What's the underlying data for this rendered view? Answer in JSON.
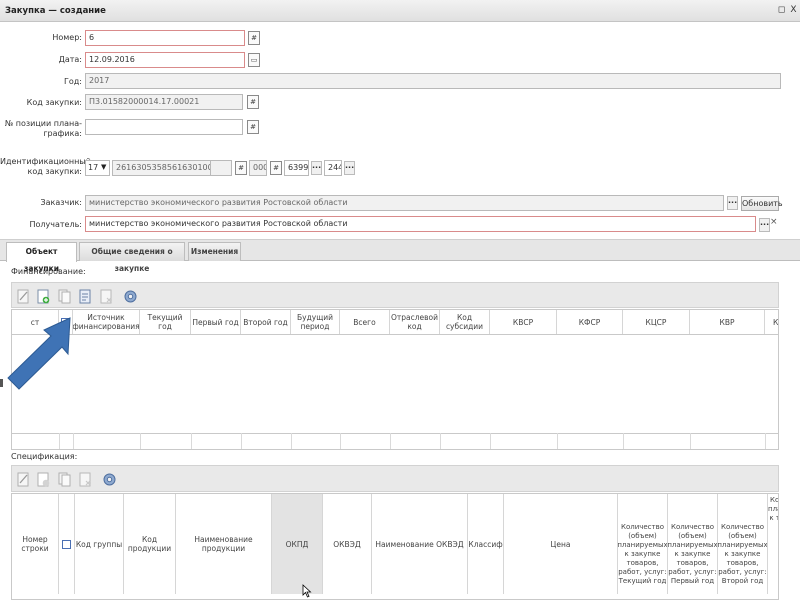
{
  "window": {
    "title": "Закупка — создание",
    "restore": "◻",
    "close": "X"
  },
  "form": {
    "number": {
      "label": "Номер:",
      "value": "6"
    },
    "date": {
      "label": "Дата:",
      "value": "12.09.2016"
    },
    "year": {
      "label": "Год:",
      "value": "2017"
    },
    "purchase_code": {
      "label": "Код закупки:",
      "value": "П3.01582000014.17.00021"
    },
    "plan_position": {
      "label": "№ позиции плана-графика:",
      "value": ""
    },
    "ident_code": {
      "label": "Идентификационный код закупки:",
      "year": "17",
      "main": "261630535856163010​01",
      "part1": "",
      "part2": "000",
      "part3": "6399",
      "part4": "244"
    },
    "customer": {
      "label": "Заказчик:",
      "value": "министерство экономического развития Ростовской области",
      "ellipsis": "...",
      "refresh_button": "Обновить"
    },
    "recipient": {
      "label": "Получатель:",
      "value": "министерство экономического развития Ростовской области",
      "ellipsis": "...",
      "clear": "×"
    }
  },
  "tabs": [
    {
      "label": "Объект закупки",
      "active": true
    },
    {
      "label": "Общие сведения о закупке",
      "active": false
    },
    {
      "label": "Изменения",
      "active": false
    }
  ],
  "financing": {
    "label": "Финансирование:",
    "columns": [
      "Источник финансирования",
      "Текущий год",
      "Первый год",
      "Второй год",
      "Будущий период",
      "Всего",
      "Отраслевой код",
      "Код субсидии",
      "КВСР",
      "КФСР",
      "КЦСР",
      "КВР",
      "К"
    ],
    "first_col": "ст"
  },
  "specification": {
    "label": "Спецификация:",
    "columns": [
      "Номер строки",
      "Код группы",
      "Код продукции",
      "Наименование продукции",
      "ОКПД",
      "ОКВЭД",
      "Наименование ОКВЭД",
      "Классиф",
      "Цена",
      "Количество (объем) планируемых к закупке товаров, работ, услуг: Текущий год",
      "Количество (объем) планируемых к закупке товаров, работ, услуг: Первый год",
      "Количество (объем) планируемых к закупке товаров, работ, услуг: Второй год",
      "Ко пла к т"
    ]
  },
  "colors": {
    "arrow": "#3f73b5",
    "required_border": "#d98b8b",
    "toolbar_bg": "#e9e9e9"
  }
}
